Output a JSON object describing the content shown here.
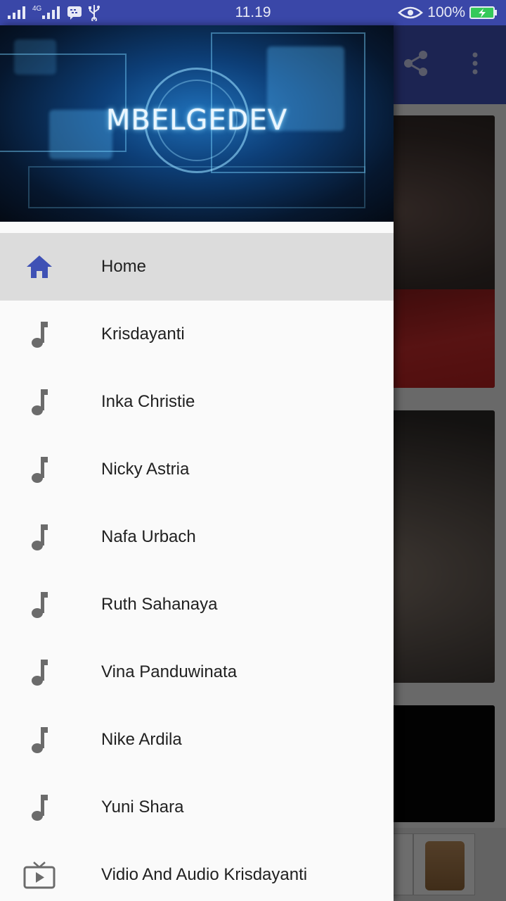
{
  "status_bar": {
    "network": "4G",
    "time": "11.19",
    "battery": "100%"
  },
  "drawer": {
    "header_title": "MBELGEDEV",
    "items": [
      {
        "label": "Home",
        "icon": "home-icon",
        "active": true
      },
      {
        "label": "Krisdayanti",
        "icon": "music-note-icon"
      },
      {
        "label": "Inka Christie",
        "icon": "music-note-icon"
      },
      {
        "label": "Nicky Astria",
        "icon": "music-note-icon"
      },
      {
        "label": "Nafa Urbach",
        "icon": "music-note-icon"
      },
      {
        "label": "Ruth Sahanaya",
        "icon": "music-note-icon"
      },
      {
        "label": "Vina Panduwinata",
        "icon": "music-note-icon"
      },
      {
        "label": "Nike Ardila",
        "icon": "music-note-icon"
      },
      {
        "label": "Yuni Shara",
        "icon": "music-note-icon"
      },
      {
        "label": "Vidio And Audio Krisdayanti",
        "icon": "tv-play-icon"
      }
    ]
  },
  "colors": {
    "primary": "#3f51b5",
    "status_bar": "#3a47a8",
    "active_item_bg": "#dcdcdc",
    "home_icon": "#3f51b5",
    "menu_icon": "#6b6b6b"
  }
}
